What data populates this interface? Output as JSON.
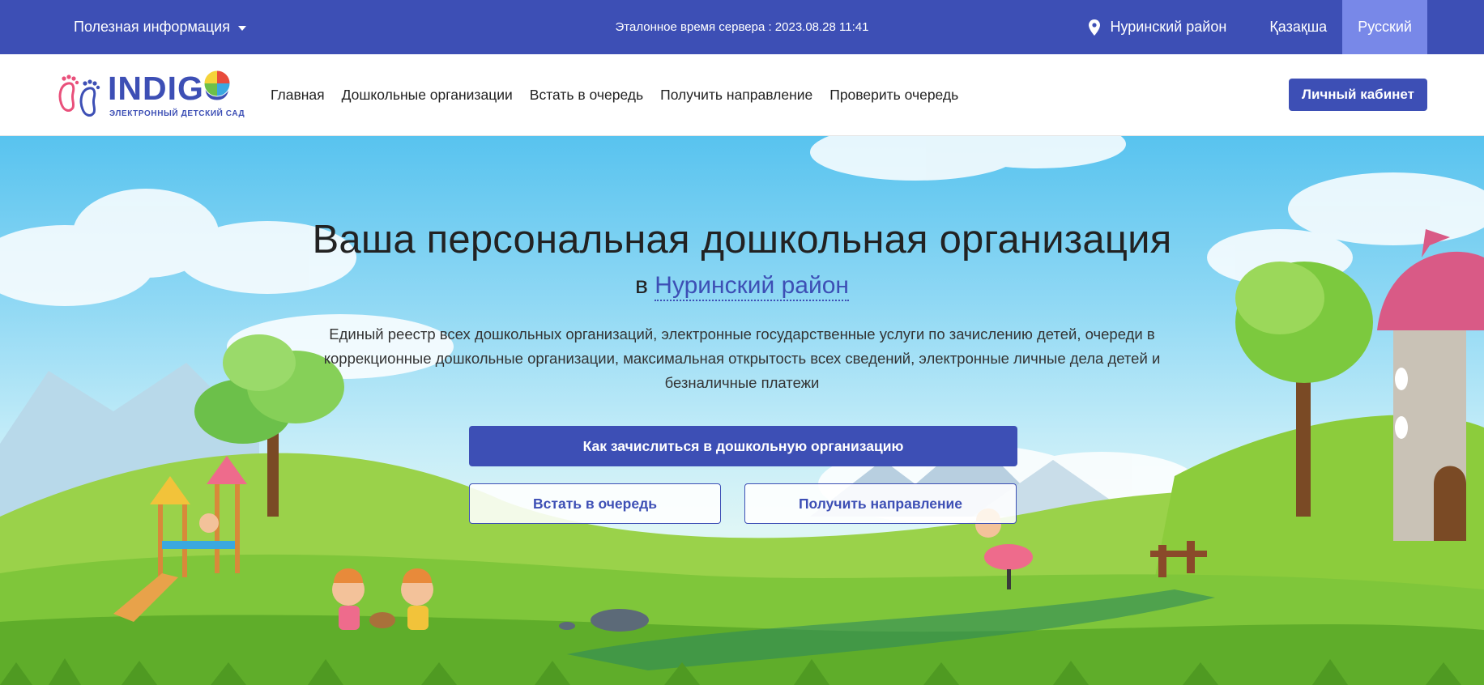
{
  "topbar": {
    "info_menu": "Полезная информация",
    "server_time": "Эталонное время сервера : 2023.08.28 11:41",
    "region": "Нуринский район",
    "languages": [
      {
        "label": "Қазақша",
        "active": false
      },
      {
        "label": "Русский",
        "active": true
      }
    ]
  },
  "logo": {
    "brand": "INDIGO",
    "tagline": "ЭЛЕКТРОННЫЙ ДЕТСКИЙ САД"
  },
  "nav": {
    "items": [
      {
        "label": "Главная"
      },
      {
        "label": "Дошкольные организации"
      },
      {
        "label": "Встать в очередь"
      },
      {
        "label": "Получить направление"
      },
      {
        "label": "Проверить очередь"
      }
    ],
    "cabinet_button": "Личный кабинет"
  },
  "hero": {
    "title": "Ваша персональная дошкольная организация",
    "subtitle_prefix": "в",
    "subtitle_region": "Нуринский район",
    "description": "Единый реестр всех дошкольных организаций, электронные государственные услуги по зачислению детей, очереди в коррекционные дошкольные организации, максимальная открытость всех сведений, электронные личные дела детей и безналичные платежи",
    "primary_button": "Как зачислиться в дошкольную организацию",
    "queue_button": "Встать в очередь",
    "direction_button": "Получить направление"
  },
  "colors": {
    "primary": "#3d4fb5",
    "active_language": "#7888e8",
    "grass": "#7fc63a",
    "sky": "#58c3ef"
  },
  "icons": {
    "info_menu": "chevron-down-icon",
    "region": "map-pin-icon"
  }
}
